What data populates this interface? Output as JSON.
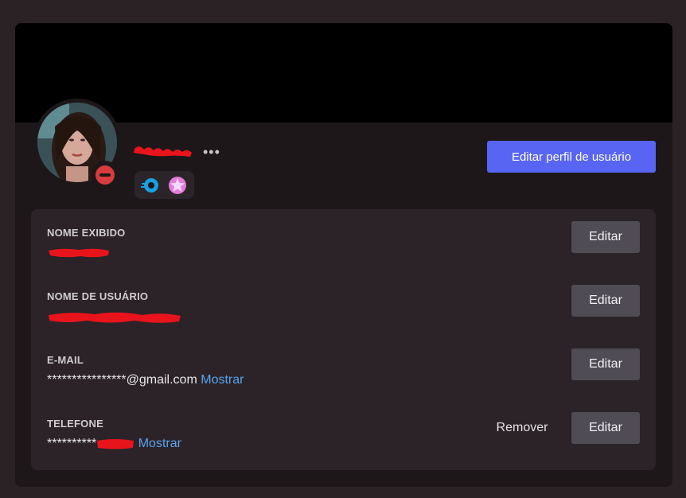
{
  "profile": {
    "edit_profile_button": "Editar perfil de usuário",
    "more_label": "•••",
    "badges": [
      "nitro-boost-icon",
      "star-badge-icon"
    ],
    "status": "do-not-disturb"
  },
  "fields": [
    {
      "label": "NOME EXIBIDO",
      "value": "",
      "show_label": "",
      "edit_label": "Editar"
    },
    {
      "label": "NOME DE USUÁRIO",
      "value": "",
      "show_label": "",
      "edit_label": "Editar"
    },
    {
      "label": "E-MAIL",
      "value": "****************@gmail.com",
      "show_label": "Mostrar",
      "edit_label": "Editar"
    },
    {
      "label": "TELEFONE",
      "value": "**********",
      "show_label": "Mostrar",
      "edit_label": "Editar",
      "remove_label": "Remover"
    }
  ],
  "colors": {
    "accent": "#5865f2",
    "link": "#5aa3ee",
    "status_dnd": "#d83c3e",
    "redaction": "#e8141c"
  }
}
